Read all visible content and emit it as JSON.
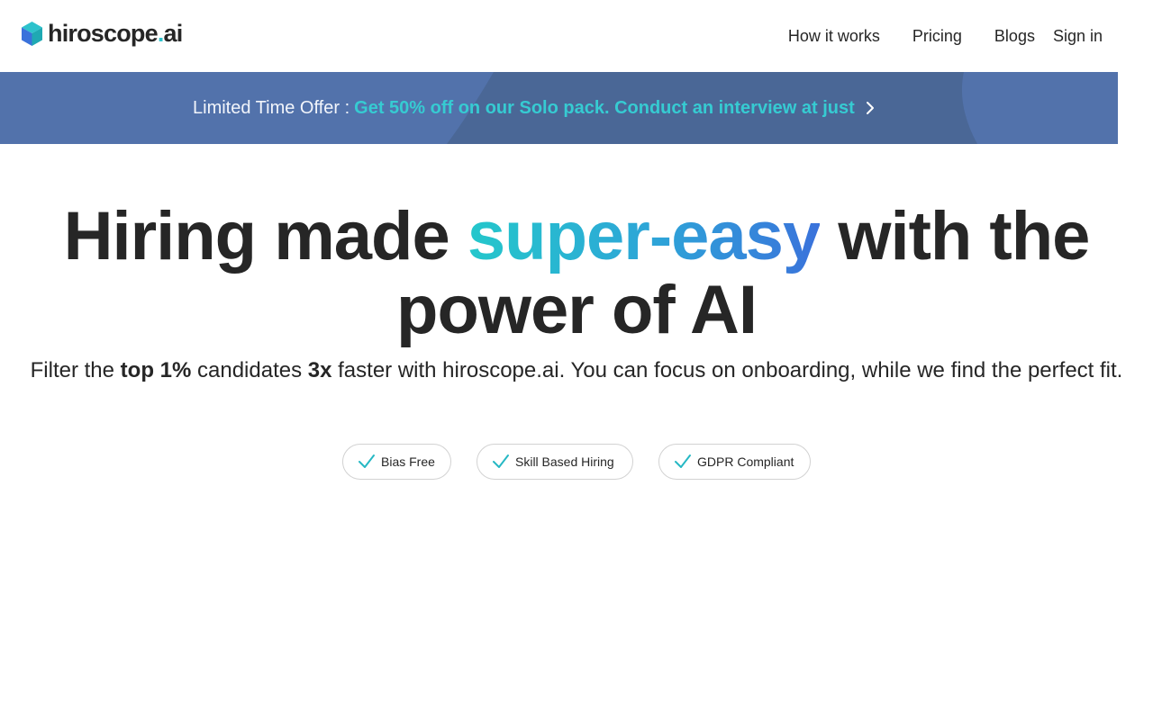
{
  "header": {
    "logo_text": "hiroscope",
    "logo_dot": ".",
    "logo_suffix": "ai",
    "nav": [
      {
        "label": "How it works"
      },
      {
        "label": "Pricing"
      },
      {
        "label": "Blogs"
      },
      {
        "label": "Sign in"
      }
    ]
  },
  "banner": {
    "prefix": "Limited Time Offer :",
    "offer": "Get 50% off on our Solo pack. Conduct an interview at just"
  },
  "hero": {
    "title_start": "Hiring made ",
    "title_accent": "super-easy",
    "title_end": " with the power of AI",
    "subtitle_1": "Filter the ",
    "subtitle_bold_1": "top 1%",
    "subtitle_2": " candidates ",
    "subtitle_bold_2": "3x",
    "subtitle_3": " faster with hiroscope.ai. You can focus on onboarding, while we find the perfect fit."
  },
  "features": [
    {
      "label": "Bias Free"
    },
    {
      "label": "Skill Based Hiring"
    },
    {
      "label": "GDPR Compliant"
    }
  ],
  "colors": {
    "brand_teal": "#2dc2cc",
    "brand_blue": "#3a72db",
    "banner_bg": "#5272ab",
    "banner_accent": "#36cbd2",
    "text_dark": "#262626"
  },
  "icons": [
    "hexagon-logo-icon",
    "chevron-right-icon",
    "check-icon"
  ]
}
